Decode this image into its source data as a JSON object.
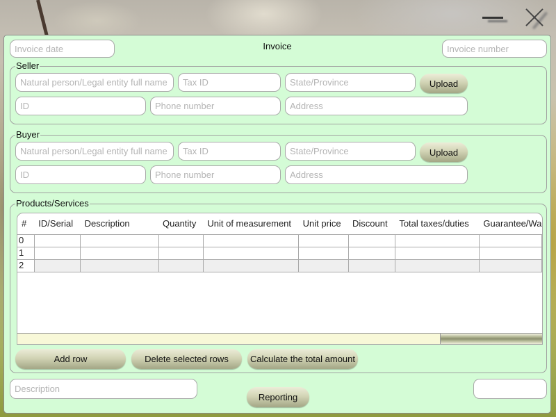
{
  "window": {
    "minimize_icon": "minimize-icon",
    "close_icon": "close-icon"
  },
  "header": {
    "title": "Invoice",
    "invoice_date_placeholder": "Invoice date",
    "invoice_date_value": "",
    "invoice_number_placeholder": "Invoice number",
    "invoice_number_value": ""
  },
  "seller": {
    "group_label": "Seller",
    "full_name_placeholder": "Natural person/Legal entity full name",
    "tax_id_placeholder": "Tax ID",
    "state_placeholder": "State/Province",
    "upload_label": "Upload",
    "id_placeholder": "ID",
    "phone_placeholder": "Phone number",
    "address_placeholder": "Address"
  },
  "buyer": {
    "group_label": "Buyer",
    "full_name_placeholder": "Natural person/Legal entity full name",
    "tax_id_placeholder": "Tax ID",
    "state_placeholder": "State/Province",
    "upload_label": "Upload",
    "id_placeholder": "ID",
    "phone_placeholder": "Phone number",
    "address_placeholder": "Address"
  },
  "products": {
    "group_label": "Products/Services",
    "columns": [
      "#",
      "ID/Serial",
      "Description",
      "Quantity",
      "Unit of measurement",
      "Unit price",
      "Discount",
      "Total taxes/duties",
      "Guarantee/Wa"
    ],
    "rows": [
      {
        "index": "0",
        "cells": [
          "",
          "",
          "",
          "",
          "",
          "",
          "",
          ""
        ]
      },
      {
        "index": "1",
        "cells": [
          "",
          "",
          "",
          "",
          "",
          "",
          "",
          ""
        ]
      },
      {
        "index": "2",
        "cells": [
          "",
          "",
          "",
          "",
          "",
          "",
          "",
          ""
        ]
      }
    ],
    "hscroll_position": 0.83,
    "add_row_label": "Add row",
    "delete_rows_label": "Delete selected rows",
    "calculate_label": "Calculate the total amount"
  },
  "footer": {
    "description_placeholder": "Description",
    "reporting_label": "Reporting",
    "total_value": ""
  }
}
